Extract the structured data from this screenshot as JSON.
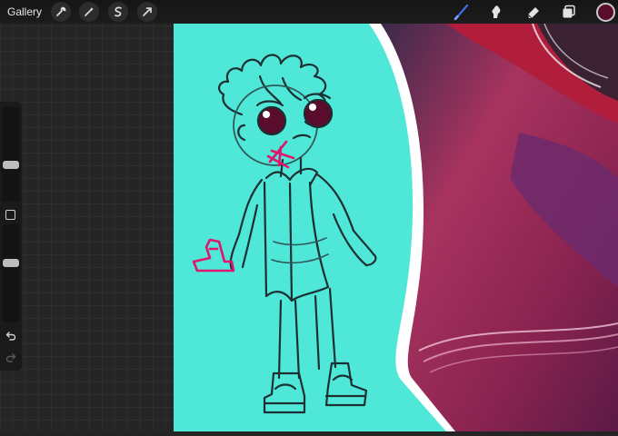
{
  "toolbar": {
    "gallery_label": "Gallery",
    "left_tools": [
      {
        "icon": "wrench-icon"
      },
      {
        "icon": "magic-wand-icon"
      },
      {
        "icon": "selection-icon"
      },
      {
        "icon": "transform-arrow-icon"
      }
    ],
    "right_tools": [
      {
        "icon": "brush-icon",
        "active": true
      },
      {
        "icon": "smudge-icon"
      },
      {
        "icon": "eraser-icon"
      },
      {
        "icon": "layers-icon"
      }
    ],
    "current_color": "#5a0c2c"
  },
  "sidebar": {
    "brush_size_level": 0.38,
    "opacity_level": 0.62,
    "undo_icon": "undo-icon",
    "redo_icon": "redo-icon"
  },
  "colors": {
    "canvas_background": "#4fe8d8",
    "sketch_stroke": "#1c2f33",
    "accent_pink": "#e0156c",
    "brush_active": "#3a6ee8"
  }
}
